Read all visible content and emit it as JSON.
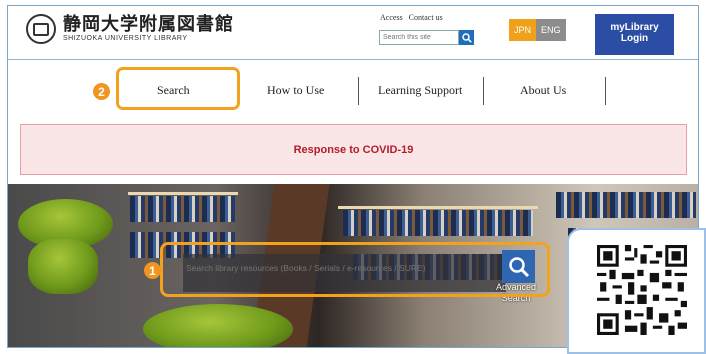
{
  "header": {
    "logo_jp": "静岡大学附属図書館",
    "logo_en": "SHIZUOKA UNIVERSITY LIBRARY",
    "top_links": [
      "Access",
      "Contact us"
    ],
    "site_search_placeholder": "Search this site",
    "lang_options": [
      "JPN",
      "ENG"
    ],
    "mylibrary_line1": "myLibrary",
    "mylibrary_line2": "Login"
  },
  "nav": {
    "items": [
      "Search",
      "How to Use",
      "Learning Support",
      "About Us"
    ]
  },
  "banner": {
    "text": "Response to COVID-19"
  },
  "hero": {
    "search_placeholder": "Search library resources (Books / Serials / e-resources / SURE)",
    "advanced_line1": "Advanced",
    "advanced_line2": "Search"
  },
  "annotations": {
    "callout_1": "1",
    "callout_2": "2"
  },
  "colors": {
    "accent_orange": "#f1a320",
    "brand_blue": "#2b4ea4",
    "banner_bg": "#fbe6e7",
    "banner_text": "#b31d2b"
  }
}
